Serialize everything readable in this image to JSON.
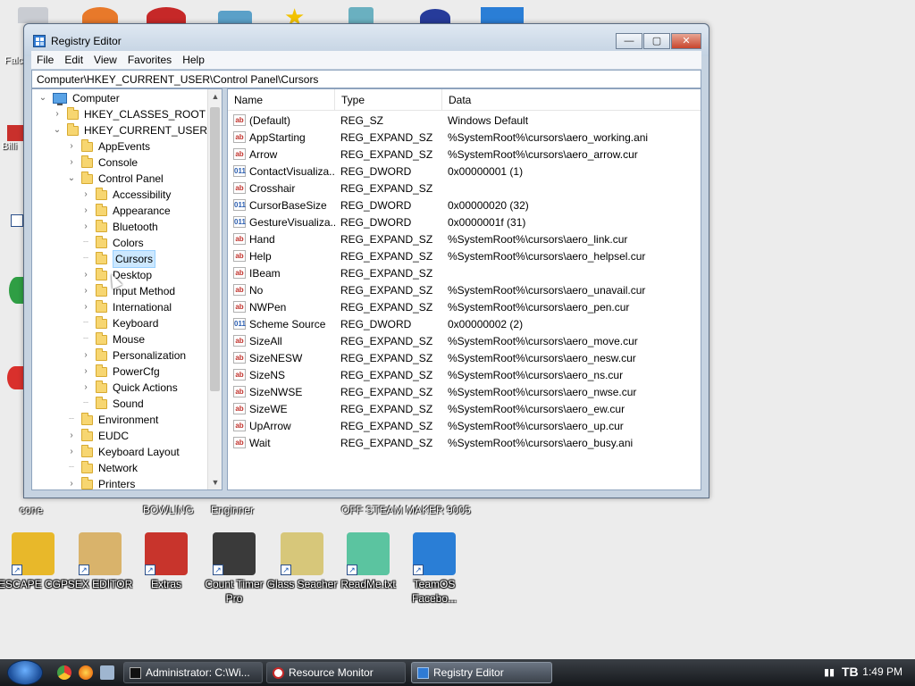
{
  "window": {
    "title": "Registry Editor",
    "minimize_glyph": "—",
    "maximize_glyph": "▢",
    "close_glyph": "✕"
  },
  "menu": [
    "File",
    "Edit",
    "View",
    "Favorites",
    "Help"
  ],
  "address": "Computer\\HKEY_CURRENT_USER\\Control Panel\\Cursors",
  "tree": [
    {
      "label": "Computer",
      "level": 0,
      "twist": "expanded",
      "icon": "computer-icon"
    },
    {
      "label": "HKEY_CLASSES_ROOT",
      "level": 1,
      "twist": "collapsed"
    },
    {
      "label": "HKEY_CURRENT_USER",
      "level": 1,
      "twist": "expanded"
    },
    {
      "label": "AppEvents",
      "level": 2,
      "twist": "collapsed"
    },
    {
      "label": "Console",
      "level": 2,
      "twist": "collapsed"
    },
    {
      "label": "Control Panel",
      "level": 2,
      "twist": "expanded"
    },
    {
      "label": "Accessibility",
      "level": 3,
      "twist": "collapsed"
    },
    {
      "label": "Appearance",
      "level": 3,
      "twist": "collapsed"
    },
    {
      "label": "Bluetooth",
      "level": 3,
      "twist": "collapsed"
    },
    {
      "label": "Colors",
      "level": 3,
      "twist": "none"
    },
    {
      "label": "Cursors",
      "level": 3,
      "twist": "none",
      "selected": true
    },
    {
      "label": "Desktop",
      "level": 3,
      "twist": "collapsed"
    },
    {
      "label": "Input Method",
      "level": 3,
      "twist": "collapsed"
    },
    {
      "label": "International",
      "level": 3,
      "twist": "collapsed"
    },
    {
      "label": "Keyboard",
      "level": 3,
      "twist": "none"
    },
    {
      "label": "Mouse",
      "level": 3,
      "twist": "none"
    },
    {
      "label": "Personalization",
      "level": 3,
      "twist": "collapsed"
    },
    {
      "label": "PowerCfg",
      "level": 3,
      "twist": "collapsed"
    },
    {
      "label": "Quick Actions",
      "level": 3,
      "twist": "collapsed"
    },
    {
      "label": "Sound",
      "level": 3,
      "twist": "none"
    },
    {
      "label": "Environment",
      "level": 2,
      "twist": "none"
    },
    {
      "label": "EUDC",
      "level": 2,
      "twist": "collapsed"
    },
    {
      "label": "Keyboard Layout",
      "level": 2,
      "twist": "collapsed"
    },
    {
      "label": "Network",
      "level": 2,
      "twist": "none"
    },
    {
      "label": "Printers",
      "level": 2,
      "twist": "collapsed"
    }
  ],
  "columns": {
    "name": "Name",
    "type": "Type",
    "data": "Data"
  },
  "values": [
    {
      "name": "(Default)",
      "type": "REG_SZ",
      "data": "Windows Default",
      "kind": "sz"
    },
    {
      "name": "AppStarting",
      "type": "REG_EXPAND_SZ",
      "data": "%SystemRoot%\\cursors\\aero_working.ani",
      "kind": "sz"
    },
    {
      "name": "Arrow",
      "type": "REG_EXPAND_SZ",
      "data": "%SystemRoot%\\cursors\\aero_arrow.cur",
      "kind": "sz"
    },
    {
      "name": "ContactVisualiza...",
      "type": "REG_DWORD",
      "data": "0x00000001 (1)",
      "kind": "dw"
    },
    {
      "name": "Crosshair",
      "type": "REG_EXPAND_SZ",
      "data": "",
      "kind": "sz"
    },
    {
      "name": "CursorBaseSize",
      "type": "REG_DWORD",
      "data": "0x00000020 (32)",
      "kind": "dw"
    },
    {
      "name": "GestureVisualiza...",
      "type": "REG_DWORD",
      "data": "0x0000001f (31)",
      "kind": "dw"
    },
    {
      "name": "Hand",
      "type": "REG_EXPAND_SZ",
      "data": "%SystemRoot%\\cursors\\aero_link.cur",
      "kind": "sz"
    },
    {
      "name": "Help",
      "type": "REG_EXPAND_SZ",
      "data": "%SystemRoot%\\cursors\\aero_helpsel.cur",
      "kind": "sz"
    },
    {
      "name": "IBeam",
      "type": "REG_EXPAND_SZ",
      "data": "",
      "kind": "sz"
    },
    {
      "name": "No",
      "type": "REG_EXPAND_SZ",
      "data": "%SystemRoot%\\cursors\\aero_unavail.cur",
      "kind": "sz"
    },
    {
      "name": "NWPen",
      "type": "REG_EXPAND_SZ",
      "data": "%SystemRoot%\\cursors\\aero_pen.cur",
      "kind": "sz"
    },
    {
      "name": "Scheme Source",
      "type": "REG_DWORD",
      "data": "0x00000002 (2)",
      "kind": "dw"
    },
    {
      "name": "SizeAll",
      "type": "REG_EXPAND_SZ",
      "data": "%SystemRoot%\\cursors\\aero_move.cur",
      "kind": "sz"
    },
    {
      "name": "SizeNESW",
      "type": "REG_EXPAND_SZ",
      "data": "%SystemRoot%\\cursors\\aero_nesw.cur",
      "kind": "sz"
    },
    {
      "name": "SizeNS",
      "type": "REG_EXPAND_SZ",
      "data": "%SystemRoot%\\cursors\\aero_ns.cur",
      "kind": "sz"
    },
    {
      "name": "SizeNWSE",
      "type": "REG_EXPAND_SZ",
      "data": "%SystemRoot%\\cursors\\aero_nwse.cur",
      "kind": "sz"
    },
    {
      "name": "SizeWE",
      "type": "REG_EXPAND_SZ",
      "data": "%SystemRoot%\\cursors\\aero_ew.cur",
      "kind": "sz"
    },
    {
      "name": "UpArrow",
      "type": "REG_EXPAND_SZ",
      "data": "%SystemRoot%\\cursors\\aero_up.cur",
      "kind": "sz"
    },
    {
      "name": "Wait",
      "type": "REG_EXPAND_SZ",
      "data": "%SystemRoot%\\cursors\\aero_busy.ani",
      "kind": "sz"
    }
  ],
  "desktop_icons": [
    {
      "label": "ESCAPE CGP",
      "icon": "escape-cgp-icon",
      "color": "#e8b82a"
    },
    {
      "label": "SEX EDITOR",
      "icon": "hxd-editor-icon",
      "color": "#d9b36b"
    },
    {
      "label": "Extras",
      "icon": "extras-book-icon",
      "color": "#c8342c"
    },
    {
      "label": "Count Timer Pro",
      "icon": "traffic-light-icon",
      "color": "#3a3a3a"
    },
    {
      "label": "Glass Seacher",
      "icon": "magnifier-icon",
      "color": "#d7c77a"
    },
    {
      "label": "ReadMe.txt",
      "icon": "notepad-icon",
      "color": "#5bc4a0"
    },
    {
      "label": "TeamOS Facebo...",
      "icon": "gear-icon",
      "color": "#2a7ed6"
    }
  ],
  "desktop_icons_partial": [
    {
      "label": "cone",
      "icon": "app-icon"
    },
    {
      "label": "BOWLING",
      "icon": "bowling-icon"
    },
    {
      "label": "Enginner",
      "icon": "engineer-icon"
    },
    {
      "label": "OFF STEAM",
      "icon": "steam-icon"
    },
    {
      "label": "MAKER 9005",
      "icon": "maker-icon"
    }
  ],
  "taskbar": {
    "tasks": [
      {
        "label": "Administrator: C:\\Wi...",
        "icon": "cmd-icon"
      },
      {
        "label": "Resource Monitor",
        "icon": "resource-monitor-icon"
      },
      {
        "label": "Registry Editor",
        "icon": "registry-icon",
        "active": true
      }
    ],
    "clock": "1:49 PM"
  }
}
